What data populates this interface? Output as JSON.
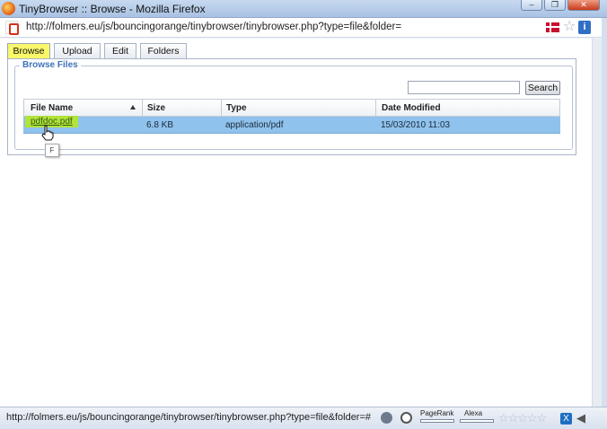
{
  "window": {
    "title": "TinyBrowser :: Browse - Mozilla Firefox",
    "minimize_glyph": "–",
    "restore_glyph": "❐",
    "close_glyph": "✕"
  },
  "address_bar": {
    "url": "http://folmers.eu/js/bouncingorange/tinybrowser/tinybrowser.php?type=file&folder="
  },
  "tabs": [
    {
      "label": "Browse",
      "active": true
    },
    {
      "label": "Upload",
      "active": false
    },
    {
      "label": "Edit",
      "active": false
    },
    {
      "label": "Folders",
      "active": false
    }
  ],
  "browse_panel": {
    "legend": "Browse Files",
    "search_value": "",
    "search_button": "Search",
    "columns": [
      "File Name",
      "Size",
      "Type",
      "Date Modified"
    ],
    "rows": [
      {
        "file_name": "pdfdoc.pdf",
        "size": "6.8 KB",
        "type": "application/pdf",
        "date_modified": "15/03/2010 11:03"
      }
    ],
    "tooltip": "F"
  },
  "status_bar": {
    "text": "http://folmers.eu/js/bouncingorange/tinybrowser/tinybrowser.php?type=file&folder=#",
    "pagerank_label": "PageRank",
    "alexa_label": "Alexa",
    "stars": "☆☆☆☆☆"
  },
  "colors": {
    "highlight": "#f9f76a",
    "selected_row": "#8fc2ec",
    "file_highlight": "#b3e23a",
    "legend_blue": "#3d73b9"
  },
  "icons": [
    "firefox-icon",
    "site-favicon",
    "flag-icon",
    "bookmark-star-icon",
    "info-icon",
    "sort-ascending-icon",
    "hand-cursor-icon"
  ]
}
